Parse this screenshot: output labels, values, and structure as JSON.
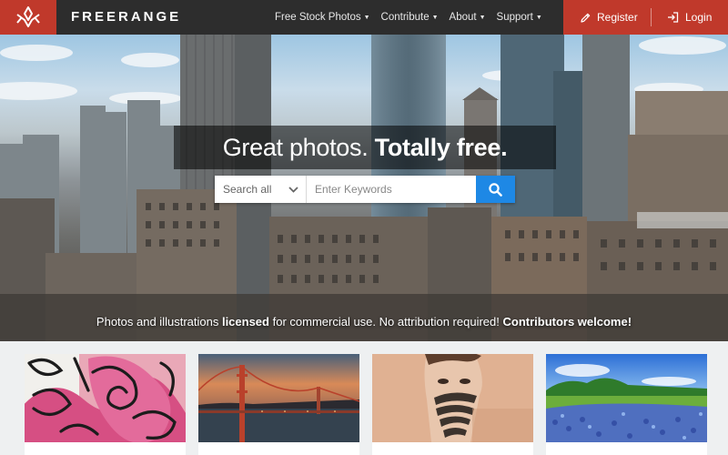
{
  "brand": {
    "name": "FREERANGE"
  },
  "nav": {
    "items": [
      {
        "label": "Free Stock Photos",
        "caret": "▼"
      },
      {
        "label": "Contribute",
        "caret": "▼"
      },
      {
        "label": "About",
        "caret": "▼"
      },
      {
        "label": "Support",
        "caret": "▼"
      }
    ],
    "register_label": "Register",
    "login_label": "Login"
  },
  "hero": {
    "headline_regular": "Great photos.",
    "headline_bold": "Totally free.",
    "search": {
      "category": "Search all",
      "placeholder": "Enter Keywords"
    },
    "tagline": {
      "part1": "Photos and illustrations ",
      "bold1": "licensed",
      "part2": " for commercial use. No attribution required! ",
      "bold2": "Contributors welcome!"
    }
  },
  "thumbnails": [
    {
      "subject": "graffiti"
    },
    {
      "subject": "golden-gate-bridge"
    },
    {
      "subject": "painted-face"
    },
    {
      "subject": "bluebonnet-field"
    }
  ],
  "colors": {
    "brand_red": "#c0392b",
    "nav_dark": "#2d2d2d",
    "search_blue": "#1e88e5",
    "page_bg": "#eef0f1"
  },
  "icons": [
    "freerange-logo-icon",
    "pencil-icon",
    "login-icon",
    "chevron-down-icon",
    "search-icon"
  ]
}
